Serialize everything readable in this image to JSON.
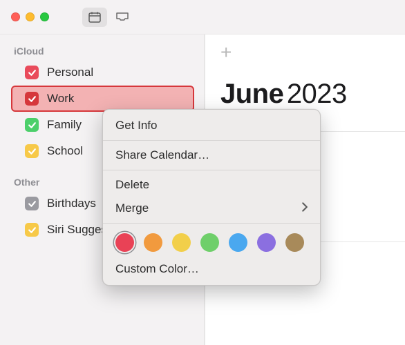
{
  "titlebar": {
    "traffic": [
      "close",
      "minimize",
      "zoom"
    ]
  },
  "sidebar": {
    "groups": [
      {
        "name": "iCloud",
        "items": [
          {
            "label": "Personal",
            "color": "#e94b5b",
            "selected": false
          },
          {
            "label": "Work",
            "color": "#e94b5b",
            "selected": true
          },
          {
            "label": "Family",
            "color": "#4ccf6a",
            "selected": false
          },
          {
            "label": "School",
            "color": "#f7c948",
            "selected": false
          }
        ]
      },
      {
        "name": "Other",
        "items": [
          {
            "label": "Birthdays",
            "color": "#9a9aa0",
            "selected": false
          },
          {
            "label": "Siri Suggestions",
            "color": "#f7c948",
            "selected": false
          }
        ]
      }
    ]
  },
  "content": {
    "month": "June",
    "year": "2023"
  },
  "context_menu": {
    "items": {
      "get_info": "Get Info",
      "share": "Share Calendar…",
      "delete": "Delete",
      "merge": "Merge",
      "custom_color": "Custom Color…"
    },
    "colors": [
      {
        "hex": "#e94256",
        "name": "red",
        "selected": true
      },
      {
        "hex": "#f19a3e",
        "name": "orange",
        "selected": false
      },
      {
        "hex": "#f2cf4a",
        "name": "yellow",
        "selected": false
      },
      {
        "hex": "#6fcf6a",
        "name": "green",
        "selected": false
      },
      {
        "hex": "#4aa8ef",
        "name": "blue",
        "selected": false
      },
      {
        "hex": "#8b6fe0",
        "name": "purple",
        "selected": false
      },
      {
        "hex": "#a88a5a",
        "name": "brown",
        "selected": false
      }
    ]
  }
}
